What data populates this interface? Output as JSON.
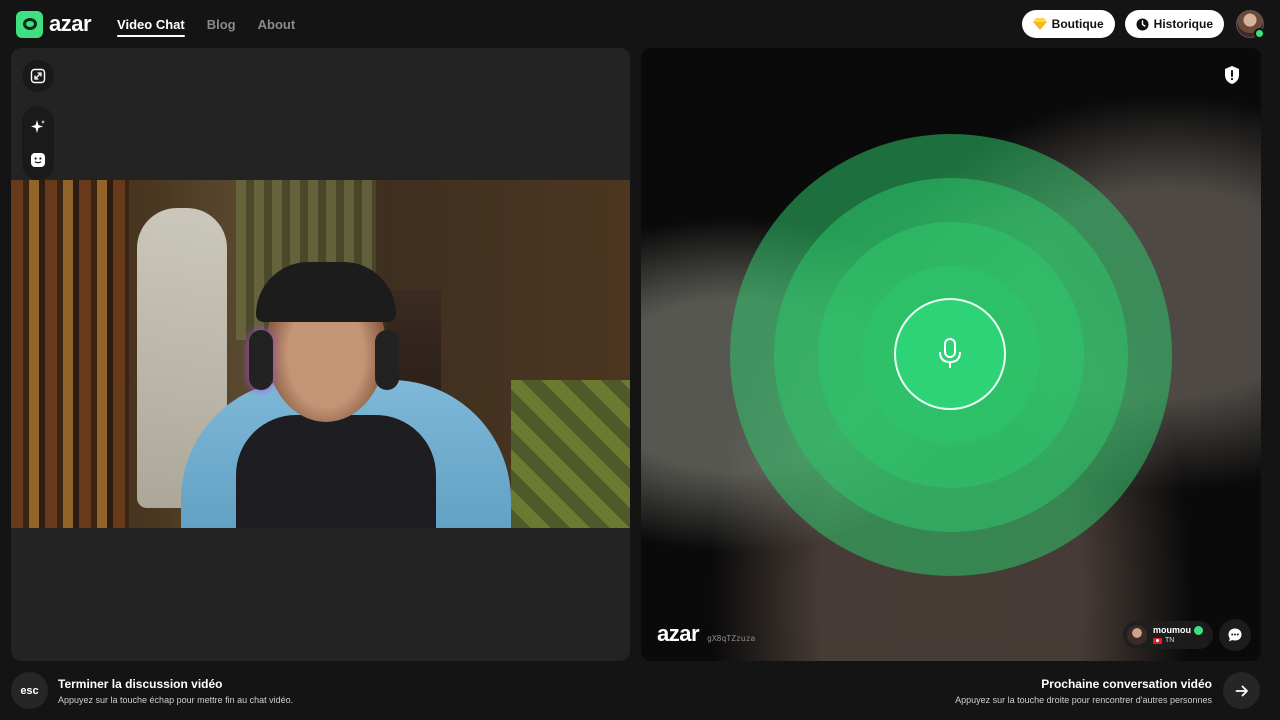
{
  "header": {
    "logo_text": "azar",
    "nav": [
      {
        "label": "Video Chat",
        "active": true
      },
      {
        "label": "Blog",
        "active": false
      },
      {
        "label": "About",
        "active": false
      }
    ],
    "shop_label": "Boutique",
    "history_label": "Historique"
  },
  "left_panel": {
    "tools": [
      "expand-icon",
      "sparkle-icon",
      "face-icon"
    ]
  },
  "right_panel": {
    "logo_text": "azar",
    "session_id": "gX8qTZzuza",
    "user": {
      "name": "moumou",
      "country": "TN",
      "verified": true
    },
    "accent_color": "#2ed277"
  },
  "footer": {
    "esc_key": "esc",
    "end_title": "Terminer la discussion vidéo",
    "end_sub": "Appuyez sur la touche échap pour mettre fin au chat vidéo.",
    "next_title": "Prochaine conversation vidéo",
    "next_sub": "Appuyez sur la touche droite pour rencontrer d'autres personnes"
  }
}
